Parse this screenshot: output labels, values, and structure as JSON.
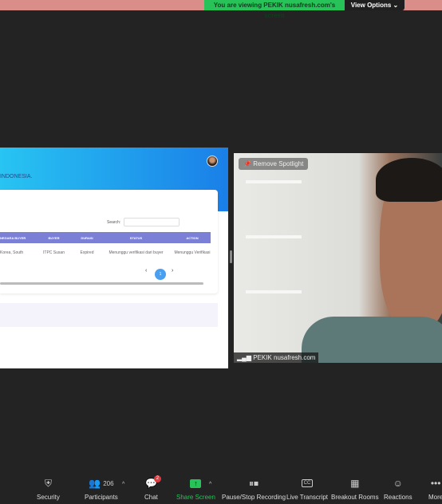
{
  "banner": {
    "text": "You are viewing PEKIK nusafresh.com's screen",
    "view_options": "View Options ⌄"
  },
  "shared_screen": {
    "header_text": "INDONESIA.",
    "search_label": "Search:",
    "columns": [
      "NEGARA BUYER",
      "BUYER",
      "DURASI",
      "STATUS",
      "ACTION"
    ],
    "rows": [
      [
        "Korea, South",
        "ITPC Susan",
        "Expired",
        "Menunggu verifikasi dari buyer",
        "Menunggu Verifikasi"
      ]
    ],
    "pagination": {
      "prev": "‹",
      "current": "1",
      "next": "›"
    }
  },
  "video": {
    "remove_spotlight": "Remove Spotlight",
    "participant_name": "PEKIK nusafresh.com"
  },
  "toolbar": {
    "security": "Security",
    "participants": "Participants",
    "participant_count": "206",
    "chat": "Chat",
    "chat_badge": "2",
    "share_screen": "Share Screen",
    "recording": "Pause/Stop Recording",
    "transcript": "Live Transcript",
    "breakout": "Breakout Rooms",
    "reactions": "Reactions",
    "more": "More"
  },
  "colors": {
    "share_green": "#27c258",
    "table_header": "#7b80d6",
    "header_blue": "#1a7fe8"
  }
}
